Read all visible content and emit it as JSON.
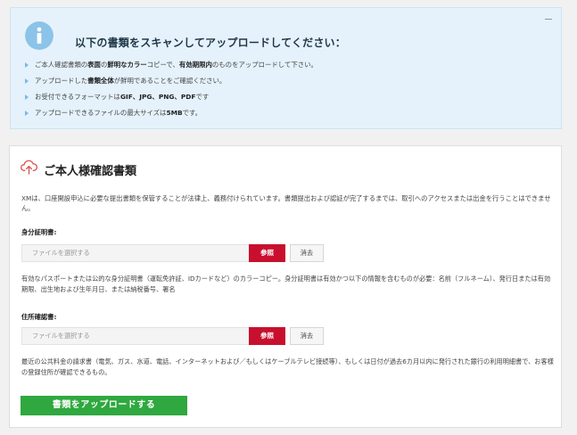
{
  "info": {
    "title": "以下の書類をスキャンしてアップロードしてください：",
    "items": [
      {
        "parts": [
          {
            "text": "ご本人確認書類の",
            "bold": false
          },
          {
            "text": "表面",
            "bold": true
          },
          {
            "text": "の",
            "bold": false
          },
          {
            "text": "鮮明なカラー",
            "bold": true
          },
          {
            "text": "コピーで、",
            "bold": false
          },
          {
            "text": "有効期限内",
            "bold": true
          },
          {
            "text": "のものをアップロードして下さい。",
            "bold": false
          }
        ]
      },
      {
        "parts": [
          {
            "text": "アップロードした",
            "bold": false
          },
          {
            "text": "書類全体",
            "bold": true
          },
          {
            "text": "が鮮明であることをご確認ください。",
            "bold": false
          }
        ]
      },
      {
        "parts": [
          {
            "text": "お受付できるフォーマットは",
            "bold": false
          },
          {
            "text": "GIF、JPG、PNG、PDF",
            "bold": true
          },
          {
            "text": "です",
            "bold": false
          }
        ]
      },
      {
        "parts": [
          {
            "text": "アップロードできるファイルの最大サイズは",
            "bold": false
          },
          {
            "text": "5MB",
            "bold": true
          },
          {
            "text": "です。",
            "bold": false
          }
        ]
      }
    ]
  },
  "doc": {
    "title": "ご本人様確認書類",
    "intro": "XMは、口座開設申込に必要な提出書類を保管することが法律上、義務付けられています。書類提出および認証が完了するまでは、取引へのアクセスまたは出金を行うことはできません。",
    "id_section": {
      "label": "身分証明書:",
      "placeholder": "ファイルを選択する",
      "browse": "参照",
      "clear": "消去",
      "desc": "有効なパスポートまたは公的な身分証明書（運転免許証、IDカードなど）のカラーコピー。身分証明書は有効かつ以下の情報を含むものが必要：名前（フルネーム）、発行日または有効期限、出生地および生年月日、または納税番号、署名"
    },
    "address_section": {
      "label": "住所確認書:",
      "placeholder": "ファイルを選択する",
      "browse": "参照",
      "clear": "消去",
      "desc": "最近の公共料金の請求書（電気、ガス、水道、電話、インターネットおよび／もしくはケーブルテレビ接続等）、もしくは日付が過去6カ月以内に発行された銀行の利用明細書で、お客様の登録住所が確認できるもの。"
    },
    "upload_label": "書類をアップロードする"
  },
  "icons": {
    "info": "info-icon",
    "upload": "cloud-upload-icon",
    "collapse": "minus-icon"
  },
  "colors": {
    "info_bg": "#e5f2fb",
    "browse_red": "#c8102e",
    "upload_green": "#2fa83f",
    "icon_red": "#d9534f"
  }
}
